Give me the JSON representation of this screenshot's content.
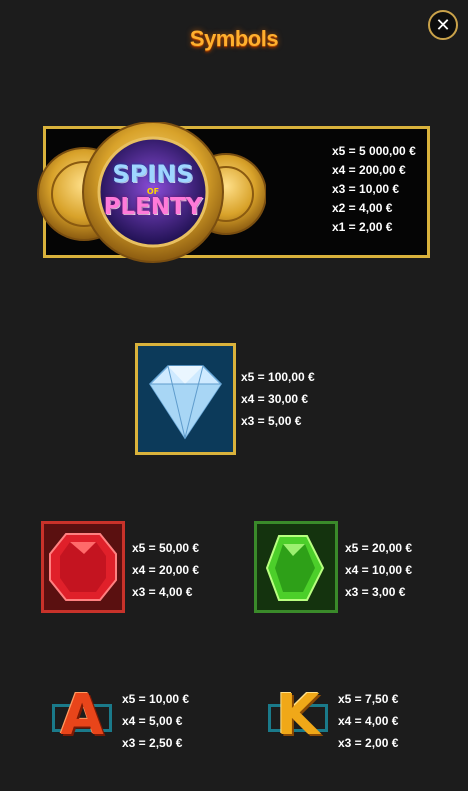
{
  "header": {
    "title": "Symbols",
    "close_icon": "close-icon"
  },
  "symbols": [
    {
      "id": "spins-of-plenty",
      "logo_line1": "SPINS",
      "logo_line2": "OF",
      "logo_line3": "PLENTY",
      "pays": [
        "x5 = 5 000,00 €",
        "x4 = 200,00 €",
        "x3 = 10,00 €",
        "x2 = 4,00 €",
        "x1 = 2,00 €"
      ]
    },
    {
      "id": "diamond",
      "pays": [
        "x5 = 100,00 €",
        "x4 = 30,00 €",
        "x3 = 5,00 €"
      ]
    },
    {
      "id": "red-gem",
      "pays": [
        "x5 = 50,00 €",
        "x4 = 20,00 €",
        "x3 = 4,00 €"
      ]
    },
    {
      "id": "green-gem",
      "pays": [
        "x5 = 20,00 €",
        "x4 = 10,00 €",
        "x3 = 3,00 €"
      ]
    },
    {
      "id": "letter-a",
      "letter": "A",
      "pays": [
        "x5 = 10,00 €",
        "x4 = 5,00 €",
        "x3 = 2,50 €"
      ]
    },
    {
      "id": "letter-k",
      "letter": "K",
      "pays": [
        "x5 = 7,50 €",
        "x4 = 4,00 €",
        "x3 = 2,00 €"
      ]
    }
  ],
  "colors": {
    "accent": "#ffb02e",
    "gold": "#d9b23c",
    "background": "#1c1c1c"
  }
}
